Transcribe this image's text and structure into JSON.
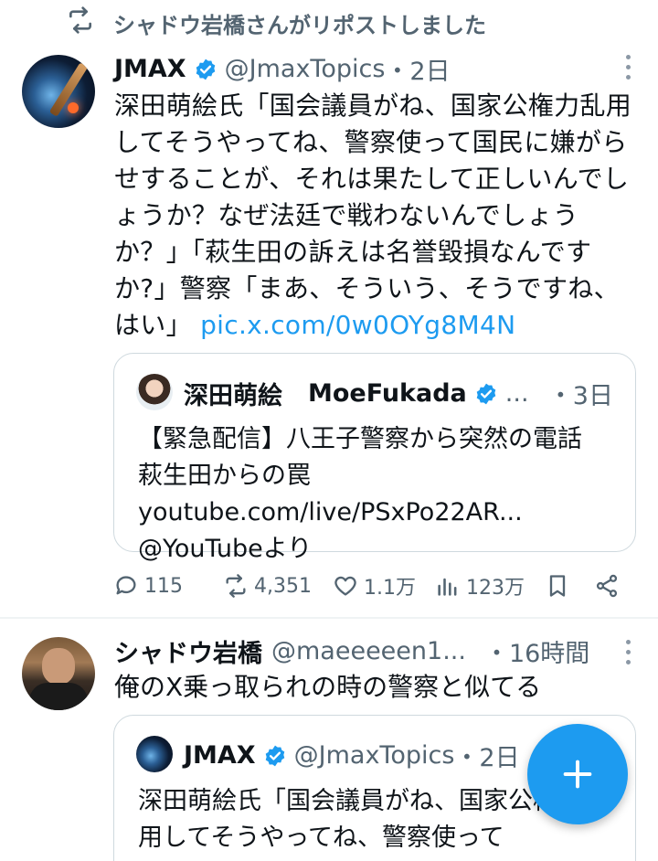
{
  "repost": {
    "text": "シャドウ岩橋さんがリポストしました"
  },
  "tweet1": {
    "name": "JMAX",
    "handle": "@JmaxTopics",
    "time": "・2日",
    "body": "深田萌絵氏「国会議員がね、国家公権力乱用してそうやってね、警察使って国民に嫌がらせすることが、それは果たして正しいんでしょうか？なぜ法廷で戦わないんでしょうか？」「萩生田の訴えは名誉毀損なんですか?」警察「まあ、そういう、そうですね、はい」",
    "link": "pic.x.com/0w0OYg8M4N",
    "quote": {
      "name": "深田萌絵",
      "display": "MoeFukada",
      "ellipsis": "...",
      "time": "・3日",
      "body": "【緊急配信】八王子警察から突然の電話　萩生田からの罠 youtube.com/live/PSxPo22AR... @YouTubeより"
    },
    "actions": {
      "replies": "115",
      "reposts": "4,351",
      "likes": "1.1万",
      "views": "123万"
    }
  },
  "tweet2": {
    "name": "シャドウ岩橋",
    "handle": "@maeeeeen1...",
    "time": "・16時間",
    "body": "俺のX乗っ取られの時の警察と似てる",
    "quote": {
      "name": "JMAX",
      "handle": "@JmaxTopics",
      "time": "・2日",
      "body": "深田萌絵氏「国会議員がね、国家公権力乱用してそうやってね、警察使って"
    }
  },
  "colors": {
    "accent": "#1d9bf0",
    "muted": "#536471",
    "border": "#cfd9de"
  }
}
